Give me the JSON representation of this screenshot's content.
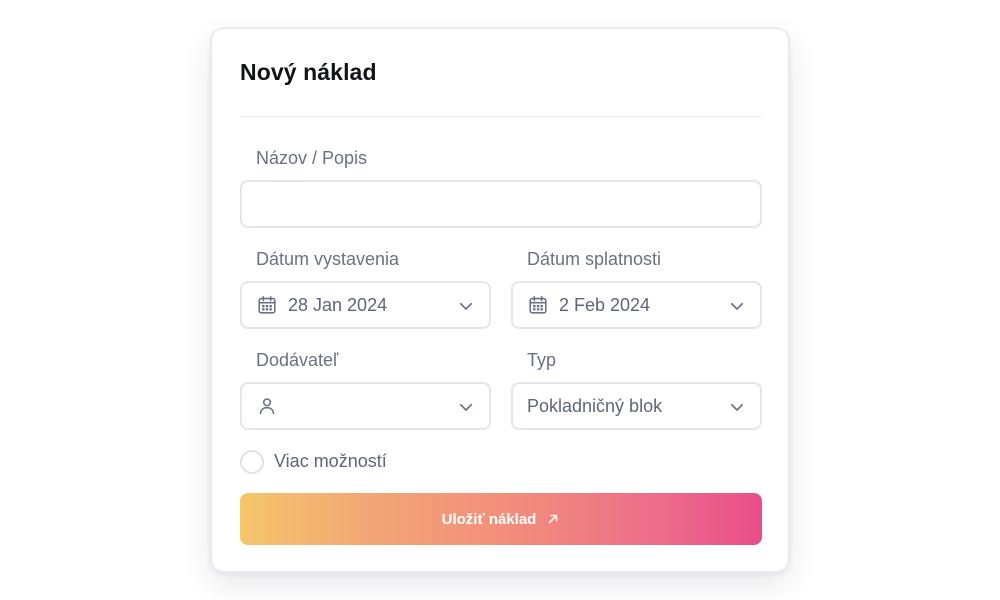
{
  "form": {
    "title": "Nový náklad",
    "fields": {
      "name": {
        "label": "Názov / Popis",
        "value": "",
        "placeholder": ""
      },
      "issue_date": {
        "label": "Dátum vystavenia",
        "value": "28 Jan 2024",
        "icon": "calendar-icon"
      },
      "due_date": {
        "label": "Dátum splatnosti",
        "value": "2 Feb 2024",
        "icon": "calendar-icon"
      },
      "supplier": {
        "label": "Dodávateľ",
        "value": "",
        "icon": "user-icon"
      },
      "type": {
        "label": "Typ",
        "value": "Pokladničný blok"
      }
    },
    "more_options": {
      "label": "Viac možností",
      "checked": false
    },
    "submit": {
      "label": "Uložiť náklad",
      "icon": "arrow-up-right-icon"
    }
  },
  "colors": {
    "title": "#111318",
    "label": "#6b7185",
    "border": "#e3e5ed",
    "button_gradient_start": "#f5c66a",
    "button_gradient_end": "#e94d8a"
  }
}
